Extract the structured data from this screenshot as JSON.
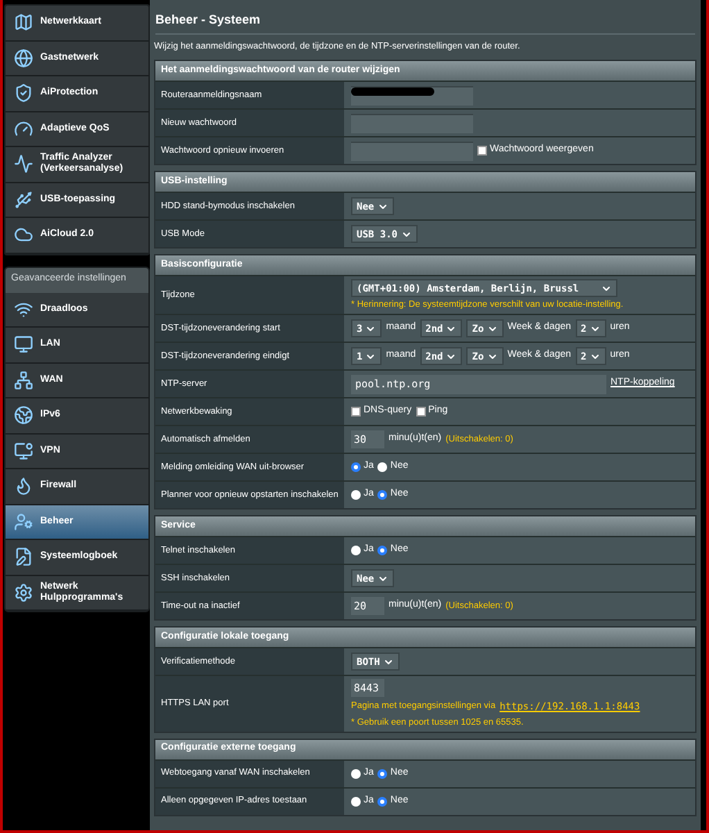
{
  "sidebar": {
    "general": [
      {
        "label": "Netwerkkaart",
        "selected": false
      },
      {
        "label": "Gastnetwerk",
        "selected": false
      },
      {
        "label": "AiProtection",
        "selected": false
      },
      {
        "label": "Adaptieve QoS",
        "selected": false
      },
      {
        "label": "Traffic Analyzer (Verkeersanalyse)",
        "selected": false
      },
      {
        "label": "USB-toepassing",
        "selected": false
      },
      {
        "label": "AiCloud 2.0",
        "selected": false
      }
    ],
    "advanced_header": "Geavanceerde instellingen",
    "advanced": [
      {
        "label": "Draadloos",
        "selected": false
      },
      {
        "label": "LAN",
        "selected": false
      },
      {
        "label": "WAN",
        "selected": false
      },
      {
        "label": "IPv6",
        "selected": false
      },
      {
        "label": "VPN",
        "selected": false
      },
      {
        "label": "Firewall",
        "selected": false
      },
      {
        "label": "Beheer",
        "selected": true
      },
      {
        "label": "Systeemlogboek",
        "selected": false
      },
      {
        "label": "Netwerk Hulpprogramma's",
        "selected": false
      }
    ]
  },
  "page": {
    "title": "Beheer - Systeem",
    "description": "Wijzig het aanmeldingswachtwoord, de tijdzone en de NTP-serverinstellingen van de router."
  },
  "sections": [
    {
      "title": "Het aanmeldingswachtwoord van de router wijzigen",
      "rows": [
        {
          "label": "Routeraanmeldingsnaam",
          "lines": [
            [
              {
                "kind": "input",
                "redacted": true
              }
            ]
          ]
        },
        {
          "label": "Nieuw wachtwoord",
          "lines": [
            [
              {
                "kind": "input"
              }
            ]
          ]
        },
        {
          "label": "Wachtwoord opnieuw invoeren",
          "lines": [
            [
              {
                "kind": "input"
              },
              {
                "kind": "checkbox",
                "label": "Wachtwoord weergeven",
                "checked": false
              }
            ]
          ]
        }
      ]
    },
    {
      "title": "USB-instelling",
      "rows": [
        {
          "label": "HDD stand-bymodus inschakelen",
          "lines": [
            [
              {
                "kind": "select",
                "value": "Nee"
              }
            ]
          ]
        },
        {
          "label": "USB Mode",
          "lines": [
            [
              {
                "kind": "select",
                "value": "USB 3.0"
              }
            ]
          ]
        }
      ]
    },
    {
      "title": "Basisconfiguratie",
      "rows": [
        {
          "label": "Tijdzone",
          "lines": [
            [
              {
                "kind": "wide_select",
                "value": "(GMT+01:00) Amsterdam, Berlijn, Brussl"
              }
            ],
            [
              {
                "kind": "hint",
                "text": "* Herinnering: De systeemtijdzone verschilt van uw locatie-instelling."
              }
            ]
          ]
        },
        {
          "label": "DST-tijdzoneverandering start",
          "lines": [
            [
              {
                "kind": "select",
                "value": "3"
              },
              {
                "kind": "text",
                "text": "maand"
              },
              {
                "kind": "select",
                "value": "2nd"
              },
              {
                "kind": "select",
                "value": "Zo"
              },
              {
                "kind": "text",
                "text": "Week & dagen"
              },
              {
                "kind": "select",
                "value": "2"
              },
              {
                "kind": "text",
                "text": "uren"
              }
            ]
          ]
        },
        {
          "label": "DST-tijdzoneverandering eindigt",
          "lines": [
            [
              {
                "kind": "select",
                "value": "1"
              },
              {
                "kind": "text",
                "text": "maand"
              },
              {
                "kind": "select",
                "value": "2nd"
              },
              {
                "kind": "select",
                "value": "Zo"
              },
              {
                "kind": "text",
                "text": "Week & dagen"
              },
              {
                "kind": "select",
                "value": "2"
              },
              {
                "kind": "text",
                "text": "uren"
              }
            ]
          ]
        },
        {
          "label": "NTP-server",
          "lines": [
            [
              {
                "kind": "wide_input",
                "value": "pool.ntp.org"
              },
              {
                "kind": "link",
                "text": "NTP-koppeling"
              }
            ]
          ]
        },
        {
          "label": "Netwerkbewaking",
          "lines": [
            [
              {
                "kind": "checkbox",
                "label": "DNS-query",
                "checked": false
              },
              {
                "kind": "checkbox",
                "label": "Ping",
                "checked": false
              }
            ]
          ]
        },
        {
          "label": "Automatisch afmelden",
          "lines": [
            [
              {
                "kind": "short_input",
                "value": "30"
              },
              {
                "kind": "text",
                "text": "minu(u)t(en)"
              },
              {
                "kind": "hint",
                "text": "(Uitschakelen: 0)"
              }
            ]
          ]
        },
        {
          "label": "Melding omleiding WAN uit-browser",
          "lines": [
            [
              {
                "kind": "radio",
                "label": "Ja",
                "selected": true
              },
              {
                "kind": "radio",
                "label": "Nee",
                "selected": false
              }
            ]
          ]
        },
        {
          "label": "Planner voor opnieuw opstarten inschakelen",
          "lines": [
            [
              {
                "kind": "radio",
                "label": "Ja",
                "selected": false
              },
              {
                "kind": "radio",
                "label": "Nee",
                "selected": true
              }
            ]
          ]
        }
      ]
    },
    {
      "title": "Service",
      "rows": [
        {
          "label": "Telnet inschakelen",
          "lines": [
            [
              {
                "kind": "radio",
                "label": "Ja",
                "selected": false
              },
              {
                "kind": "radio",
                "label": "Nee",
                "selected": true
              }
            ]
          ]
        },
        {
          "label": "SSH inschakelen",
          "lines": [
            [
              {
                "kind": "select",
                "value": "Nee"
              }
            ]
          ]
        },
        {
          "label": "Time-out na inactief",
          "lines": [
            [
              {
                "kind": "short_input",
                "value": "20"
              },
              {
                "kind": "text",
                "text": "minu(u)t(en)"
              },
              {
                "kind": "hint",
                "text": "(Uitschakelen: 0)"
              }
            ]
          ]
        }
      ]
    },
    {
      "title": "Configuratie lokale toegang",
      "rows": [
        {
          "label": "Verificatiemethode",
          "lines": [
            [
              {
                "kind": "select",
                "value": "BOTH"
              }
            ]
          ]
        },
        {
          "label": "HTTPS LAN port",
          "lines": [
            [
              {
                "kind": "short_input",
                "value": "8443"
              }
            ],
            [
              {
                "kind": "hint",
                "text": "Pagina met toegangsinstellingen via"
              },
              {
                "kind": "hint_link",
                "text": "https://192.168.1.1:8443"
              }
            ],
            [
              {
                "kind": "hint",
                "text": "* Gebruik een poort tussen 1025 en 65535."
              }
            ]
          ]
        }
      ]
    },
    {
      "title": "Configuratie externe toegang",
      "rows": [
        {
          "label": "Webtoegang vanaf WAN inschakelen",
          "lines": [
            [
              {
                "kind": "radio",
                "label": "Ja",
                "selected": false
              },
              {
                "kind": "radio",
                "label": "Nee",
                "selected": true
              }
            ]
          ]
        },
        {
          "label": "Alleen opgegeven IP-adres toestaan",
          "lines": [
            [
              {
                "kind": "radio",
                "label": "Ja",
                "selected": false
              },
              {
                "kind": "radio",
                "label": "Nee",
                "selected": true
              }
            ]
          ]
        }
      ]
    }
  ]
}
